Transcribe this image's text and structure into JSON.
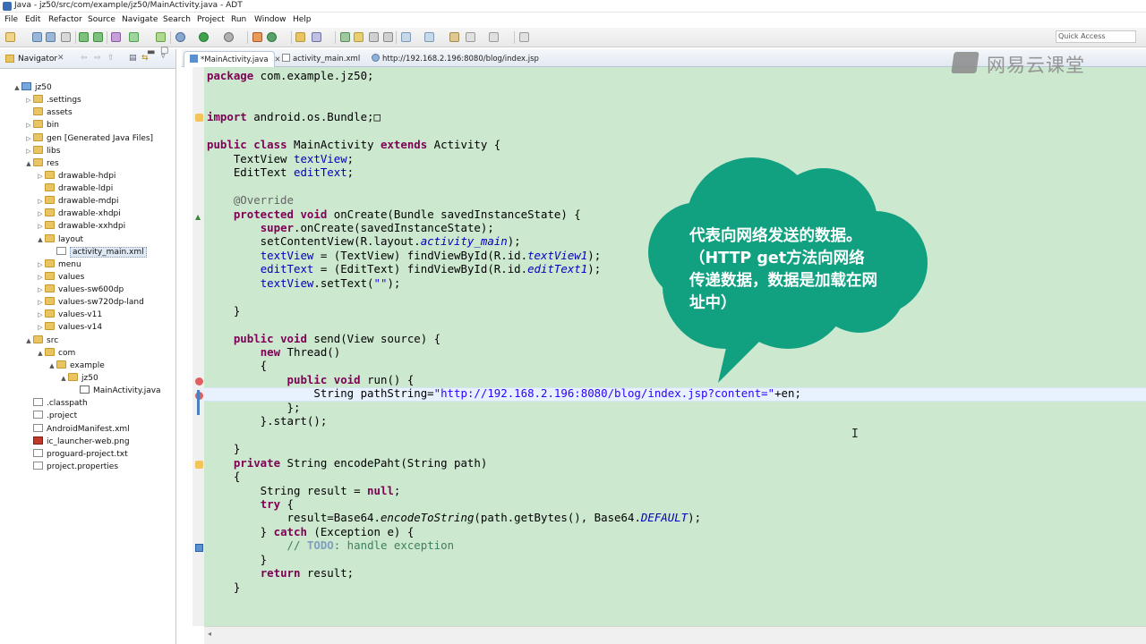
{
  "window": {
    "title": "Java - jz50/src/com/example/jz50/MainActivity.java - ADT"
  },
  "menu": [
    "File",
    "Edit",
    "Refactor",
    "Source",
    "Navigate",
    "Search",
    "Project",
    "Run",
    "Window",
    "Help"
  ],
  "toolbar": {
    "quick_access_placeholder": "Quick Access"
  },
  "navigator": {
    "title": "Navigator",
    "tree": [
      {
        "label": "jz50",
        "icon": "project-icon",
        "arrow": "▲",
        "indent": 0
      },
      {
        "label": ".settings",
        "icon": "folder-icon",
        "arrow": "▷",
        "indent": 1
      },
      {
        "label": "assets",
        "icon": "folder-icon",
        "arrow": "",
        "indent": 1
      },
      {
        "label": "bin",
        "icon": "folder-icon",
        "arrow": "▷",
        "indent": 1
      },
      {
        "label": "gen [Generated Java Files]",
        "icon": "folder-icon",
        "arrow": "▷",
        "indent": 1
      },
      {
        "label": "libs",
        "icon": "folder-icon",
        "arrow": "▷",
        "indent": 1
      },
      {
        "label": "res",
        "icon": "folder-icon",
        "arrow": "▲",
        "indent": 1
      },
      {
        "label": "drawable-hdpi",
        "icon": "folder-icon",
        "arrow": "▷",
        "indent": 2
      },
      {
        "label": "drawable-ldpi",
        "icon": "folder-icon",
        "arrow": "",
        "indent": 2
      },
      {
        "label": "drawable-mdpi",
        "icon": "folder-icon",
        "arrow": "▷",
        "indent": 2
      },
      {
        "label": "drawable-xhdpi",
        "icon": "folder-icon",
        "arrow": "▷",
        "indent": 2
      },
      {
        "label": "drawable-xxhdpi",
        "icon": "folder-icon",
        "arrow": "▷",
        "indent": 2
      },
      {
        "label": "layout",
        "icon": "folder-icon",
        "arrow": "▲",
        "indent": 2
      },
      {
        "label": "activity_main.xml",
        "icon": "xml-file-icon",
        "arrow": "",
        "indent": 3,
        "selected": true
      },
      {
        "label": "menu",
        "icon": "folder-icon",
        "arrow": "▷",
        "indent": 2
      },
      {
        "label": "values",
        "icon": "folder-icon",
        "arrow": "▷",
        "indent": 2
      },
      {
        "label": "values-sw600dp",
        "icon": "folder-icon",
        "arrow": "▷",
        "indent": 2
      },
      {
        "label": "values-sw720dp-land",
        "icon": "folder-icon",
        "arrow": "▷",
        "indent": 2
      },
      {
        "label": "values-v11",
        "icon": "folder-icon",
        "arrow": "▷",
        "indent": 2
      },
      {
        "label": "values-v14",
        "icon": "folder-icon",
        "arrow": "▷",
        "indent": 2
      },
      {
        "label": "src",
        "icon": "folder-icon",
        "arrow": "▲",
        "indent": 1
      },
      {
        "label": "com",
        "icon": "folder-icon",
        "arrow": "▲",
        "indent": 2
      },
      {
        "label": "example",
        "icon": "folder-icon",
        "arrow": "▲",
        "indent": 3
      },
      {
        "label": "jz50",
        "icon": "folder-icon",
        "arrow": "▲",
        "indent": 4
      },
      {
        "label": "MainActivity.java",
        "icon": "java-file-icon",
        "arrow": "",
        "indent": 5
      },
      {
        "label": ".classpath",
        "icon": "xml-file-icon",
        "arrow": "",
        "indent": 1
      },
      {
        "label": ".project",
        "icon": "xml-file-icon",
        "arrow": "",
        "indent": 1
      },
      {
        "label": "AndroidManifest.xml",
        "icon": "xml-file-icon",
        "arrow": "",
        "indent": 1
      },
      {
        "label": "ic_launcher-web.png",
        "icon": "png-file-icon",
        "arrow": "",
        "indent": 1
      },
      {
        "label": "proguard-project.txt",
        "icon": "text-file-icon",
        "arrow": "",
        "indent": 1
      },
      {
        "label": "project.properties",
        "icon": "text-file-icon",
        "arrow": "",
        "indent": 1
      }
    ]
  },
  "editor": {
    "tabs": [
      {
        "label": "*MainActivity.java",
        "close": "✕",
        "active": true
      },
      {
        "label": "activity_main.xml",
        "close": "",
        "active": false
      },
      {
        "label": "http://192.168.2.196:8080/blog/index.jsp",
        "close": "",
        "active": false
      }
    ],
    "code_lines": [
      [
        {
          "t": "package",
          "c": "kw"
        },
        {
          "t": " com.example.jz50;"
        }
      ],
      [],
      [],
      [
        {
          "t": "import",
          "c": "kw"
        },
        {
          "t": " android.os.Bundle;"
        },
        {
          "t": "□"
        }
      ],
      [],
      [
        {
          "t": "public",
          "c": "kw"
        },
        {
          "t": " "
        },
        {
          "t": "class",
          "c": "kw"
        },
        {
          "t": " MainActivity "
        },
        {
          "t": "extends",
          "c": "kw"
        },
        {
          "t": " Activity {"
        }
      ],
      [
        {
          "t": "    TextView "
        },
        {
          "t": "textView",
          "c": "fld"
        },
        {
          "t": ";"
        }
      ],
      [
        {
          "t": "    EditText "
        },
        {
          "t": "editText",
          "c": "fld"
        },
        {
          "t": ";"
        }
      ],
      [],
      [
        {
          "t": "    "
        },
        {
          "t": "@Override",
          "c": "ann"
        }
      ],
      [
        {
          "t": "    "
        },
        {
          "t": "protected",
          "c": "kw"
        },
        {
          "t": " "
        },
        {
          "t": "void",
          "c": "kw"
        },
        {
          "t": " onCreate(Bundle savedInstanceState) {"
        }
      ],
      [
        {
          "t": "        "
        },
        {
          "t": "super",
          "c": "kw"
        },
        {
          "t": ".onCreate(savedInstanceState);"
        }
      ],
      [
        {
          "t": "        setContentView(R.layout."
        },
        {
          "t": "activity_main",
          "c": "fldi"
        },
        {
          "t": ");"
        }
      ],
      [
        {
          "t": "        "
        },
        {
          "t": "textView",
          "c": "fld"
        },
        {
          "t": " = (TextView) findViewById(R.id."
        },
        {
          "t": "textView1",
          "c": "fldi"
        },
        {
          "t": ");"
        }
      ],
      [
        {
          "t": "        "
        },
        {
          "t": "editText",
          "c": "fld"
        },
        {
          "t": " = (EditText) findViewById(R.id."
        },
        {
          "t": "editText1",
          "c": "fldi"
        },
        {
          "t": ");"
        }
      ],
      [
        {
          "t": "        "
        },
        {
          "t": "textView",
          "c": "fld"
        },
        {
          "t": ".setText("
        },
        {
          "t": "\"\"",
          "c": "str"
        },
        {
          "t": ");"
        }
      ],
      [],
      [
        {
          "t": "    }"
        }
      ],
      [],
      [
        {
          "t": "    "
        },
        {
          "t": "public",
          "c": "kw"
        },
        {
          "t": " "
        },
        {
          "t": "void",
          "c": "kw"
        },
        {
          "t": " send(View source) {"
        }
      ],
      [
        {
          "t": "        "
        },
        {
          "t": "new",
          "c": "kw"
        },
        {
          "t": " Thread()"
        }
      ],
      [
        {
          "t": "        {"
        }
      ],
      [
        {
          "t": "            "
        },
        {
          "t": "public",
          "c": "kw"
        },
        {
          "t": " "
        },
        {
          "t": "void",
          "c": "kw"
        },
        {
          "t": " run() {"
        }
      ],
      [
        {
          "t": "                String pathString="
        },
        {
          "t": "\"http://192.168.2.196:8080/blog/index.jsp?content=\"",
          "c": "str"
        },
        {
          "t": "+en;"
        }
      ],
      [
        {
          "t": "            };"
        }
      ],
      [
        {
          "t": "        }.start();"
        }
      ],
      [],
      [
        {
          "t": "    }"
        }
      ],
      [
        {
          "t": "    "
        },
        {
          "t": "private",
          "c": "kw"
        },
        {
          "t": " String encodePaht(String path)"
        }
      ],
      [
        {
          "t": "    {"
        }
      ],
      [
        {
          "t": "        String result = "
        },
        {
          "t": "null",
          "c": "kw"
        },
        {
          "t": ";"
        }
      ],
      [
        {
          "t": "        "
        },
        {
          "t": "try",
          "c": "kw"
        },
        {
          "t": " {"
        }
      ],
      [
        {
          "t": "            result=Base64."
        },
        {
          "t": "encodeToString",
          "c": "mi"
        },
        {
          "t": "(path.getBytes(), Base64."
        },
        {
          "t": "DEFAULT",
          "c": "fldi"
        },
        {
          "t": ");"
        }
      ],
      [
        {
          "t": "        } "
        },
        {
          "t": "catch",
          "c": "kw"
        },
        {
          "t": " (Exception e) {"
        }
      ],
      [
        {
          "t": "            "
        },
        {
          "t": "// ",
          "c": "cmt"
        },
        {
          "t": "TODO",
          "c": "todo"
        },
        {
          "t": ": handle exception",
          "c": "cmt"
        }
      ],
      [
        {
          "t": "        }"
        }
      ],
      [
        {
          "t": "        "
        },
        {
          "t": "return",
          "c": "kw"
        },
        {
          "t": " result;"
        }
      ],
      [
        {
          "t": "    }"
        }
      ]
    ]
  },
  "watermark": {
    "text": "网易云课堂"
  },
  "callout": {
    "text": "代表向网络发送的数据。（HTTP get方法向网络传递数据，数据是加载在网址中）"
  },
  "colors": {
    "editor_bg": "#cce8cf",
    "callout": "#11a181",
    "keyword": "#7f0055",
    "string": "#2a00ff"
  }
}
